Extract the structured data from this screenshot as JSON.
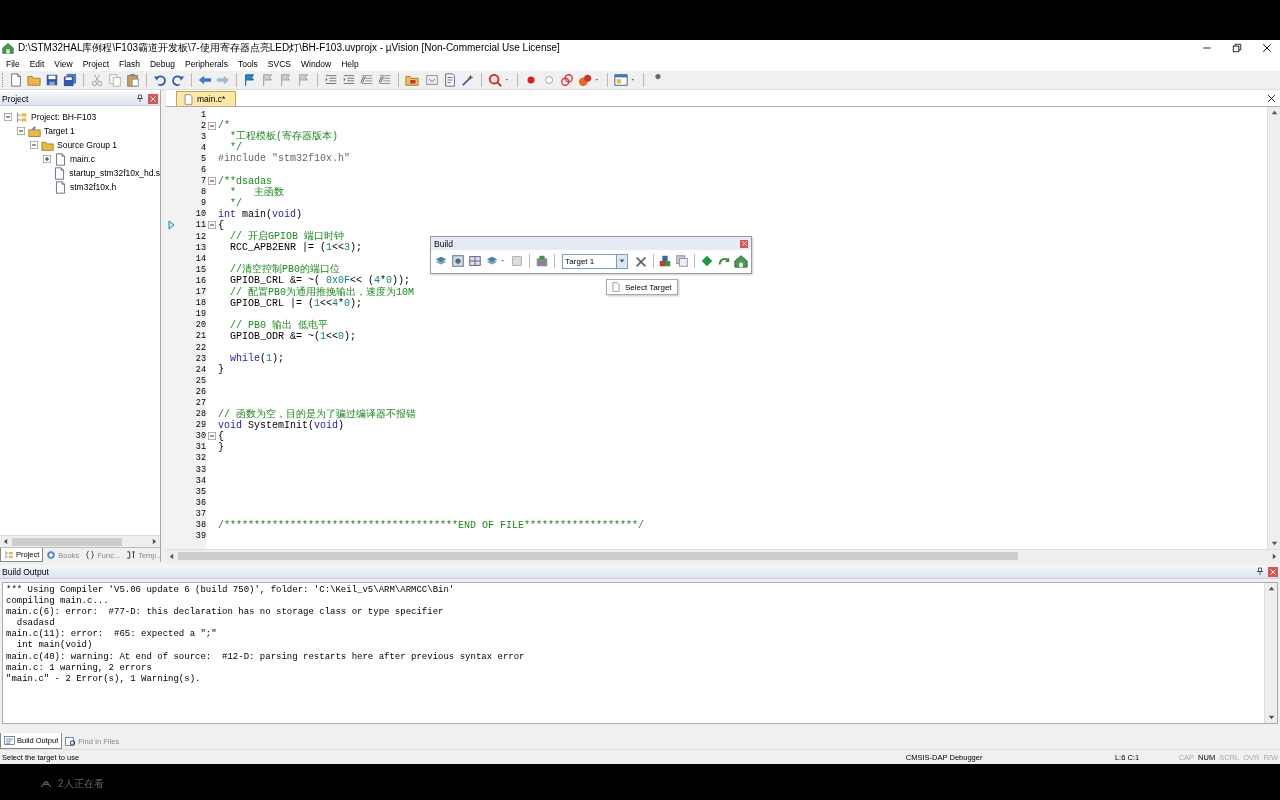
{
  "window": {
    "title": "D:\\STM32HAL库例程\\F103霸道开发板\\7-使用寄存器点亮LED灯\\BH-F103.uvprojx - µVision  [Non-Commercial Use License]"
  },
  "menu": [
    "File",
    "Edit",
    "View",
    "Project",
    "Flash",
    "Debug",
    "Peripherals",
    "Tools",
    "SVCS",
    "Window",
    "Help"
  ],
  "project_pane": {
    "title": "Project",
    "tree": [
      {
        "label": "Project: BH-F103",
        "kind": "project",
        "expanded": true,
        "children": [
          {
            "label": "Target 1",
            "kind": "target",
            "expanded": true,
            "children": [
              {
                "label": "Source Group 1",
                "kind": "group",
                "expanded": true,
                "children": [
                  {
                    "label": "main.c",
                    "kind": "file",
                    "expanded": false
                  },
                  {
                    "label": "startup_stm32f10x_hd.s",
                    "kind": "file"
                  },
                  {
                    "label": "stm32f10x.h",
                    "kind": "file"
                  }
                ]
              }
            ]
          }
        ]
      }
    ],
    "tabs": [
      {
        "label": "Project",
        "selected": true
      },
      {
        "label": "Books",
        "selected": false
      },
      {
        "label": "Func...",
        "selected": false
      },
      {
        "label": "Temp...",
        "selected": false
      }
    ]
  },
  "editor": {
    "tabs": [
      {
        "label": "main.c*",
        "selected": true
      }
    ],
    "lines": [
      {
        "number": "1",
        "fold": false,
        "current": false
      },
      {
        "number": "2",
        "fold": true,
        "current": false,
        "tokens": [
          {
            "kind": "comment",
            "text": "/*"
          }
        ]
      },
      {
        "number": "3",
        "fold": false,
        "current": false,
        "tokens": [
          {
            "kind": "comment",
            "text": "  *工程模板(寄存器版本)"
          }
        ]
      },
      {
        "number": "4",
        "fold": false,
        "current": false,
        "tokens": [
          {
            "kind": "comment",
            "text": "  */"
          }
        ]
      },
      {
        "number": "5",
        "fold": false,
        "current": false,
        "tokens": [
          {
            "kind": "preprocessor",
            "text": "#include \"stm32f10x.h\""
          }
        ]
      },
      {
        "number": "6",
        "fold": false,
        "current": false
      },
      {
        "number": "7",
        "fold": true,
        "current": false,
        "tokens": [
          {
            "kind": "comment",
            "text": "/**dsadas"
          }
        ]
      },
      {
        "number": "8",
        "fold": false,
        "current": false,
        "tokens": [
          {
            "kind": "comment",
            "text": "  *   主函数"
          }
        ]
      },
      {
        "number": "9",
        "fold": false,
        "current": false,
        "tokens": [
          {
            "kind": "comment",
            "text": "  */"
          }
        ]
      },
      {
        "number": "10",
        "fold": false,
        "current": false,
        "tokens": [
          {
            "kind": "keyword",
            "text": "int"
          },
          {
            "kind": "plain",
            "text": " main("
          },
          {
            "kind": "keyword",
            "text": "void"
          },
          {
            "kind": "plain",
            "text": ")"
          }
        ]
      },
      {
        "number": "11",
        "fold": true,
        "current": true,
        "tokens": [
          {
            "kind": "plain",
            "text": "{"
          }
        ]
      },
      {
        "number": "12",
        "fold": false,
        "current": false,
        "tokens": [
          {
            "kind": "comment",
            "text": "  // 开启GPIOB 端口时钟"
          }
        ]
      },
      {
        "number": "13",
        "fold": false,
        "current": false,
        "tokens": [
          {
            "kind": "plain",
            "text": "  RCC_APB2ENR |= ("
          },
          {
            "kind": "number",
            "text": "1"
          },
          {
            "kind": "plain",
            "text": "<<"
          },
          {
            "kind": "number",
            "text": "3"
          },
          {
            "kind": "plain",
            "text": ");"
          }
        ]
      },
      {
        "number": "14",
        "fold": false,
        "current": false
      },
      {
        "number": "15",
        "fold": false,
        "current": false,
        "tokens": [
          {
            "kind": "comment",
            "text": "  //清空控制PB0的端口位"
          }
        ]
      },
      {
        "number": "16",
        "fold": false,
        "current": false,
        "tokens": [
          {
            "kind": "plain",
            "text": "  GPIOB_CRL &= ~( "
          },
          {
            "kind": "number",
            "text": "0x0F"
          },
          {
            "kind": "plain",
            "text": "<< ("
          },
          {
            "kind": "number",
            "text": "4"
          },
          {
            "kind": "plain",
            "text": "*"
          },
          {
            "kind": "number",
            "text": "0"
          },
          {
            "kind": "plain",
            "text": "));"
          }
        ]
      },
      {
        "number": "17",
        "fold": false,
        "current": false,
        "tokens": [
          {
            "kind": "comment",
            "text": "  // 配置PB0为通用推挽输出，速度为10M"
          }
        ]
      },
      {
        "number": "18",
        "fold": false,
        "current": false,
        "tokens": [
          {
            "kind": "plain",
            "text": "  GPIOB_CRL |= ("
          },
          {
            "kind": "number",
            "text": "1"
          },
          {
            "kind": "plain",
            "text": "<<"
          },
          {
            "kind": "number",
            "text": "4"
          },
          {
            "kind": "plain",
            "text": "*"
          },
          {
            "kind": "number",
            "text": "0"
          },
          {
            "kind": "plain",
            "text": ");"
          }
        ]
      },
      {
        "number": "19",
        "fold": false,
        "current": false
      },
      {
        "number": "20",
        "fold": false,
        "current": false,
        "tokens": [
          {
            "kind": "comment",
            "text": "  // PB0 输出 低电平"
          }
        ]
      },
      {
        "number": "21",
        "fold": false,
        "current": false,
        "tokens": [
          {
            "kind": "plain",
            "text": "  GPIOB_ODR &= ~("
          },
          {
            "kind": "number",
            "text": "1"
          },
          {
            "kind": "plain",
            "text": "<<"
          },
          {
            "kind": "number",
            "text": "0"
          },
          {
            "kind": "plain",
            "text": ");"
          }
        ]
      },
      {
        "number": "22",
        "fold": false,
        "current": false
      },
      {
        "number": "23",
        "fold": false,
        "current": false,
        "tokens": [
          {
            "kind": "keyword",
            "text": "  while"
          },
          {
            "kind": "plain",
            "text": "("
          },
          {
            "kind": "number",
            "text": "1"
          },
          {
            "kind": "plain",
            "text": ");"
          }
        ]
      },
      {
        "number": "24",
        "fold": false,
        "current": false,
        "tokens": [
          {
            "kind": "plain",
            "text": "}"
          }
        ]
      },
      {
        "number": "25",
        "fold": false,
        "current": false
      },
      {
        "number": "26",
        "fold": false,
        "current": false
      },
      {
        "number": "27",
        "fold": false,
        "current": false
      },
      {
        "number": "28",
        "fold": false,
        "current": false,
        "tokens": [
          {
            "kind": "comment",
            "text": "// 函数为空，目的是为了骗过编译器不报错"
          }
        ]
      },
      {
        "number": "29",
        "fold": false,
        "current": false,
        "tokens": [
          {
            "kind": "keyword",
            "text": "void"
          },
          {
            "kind": "plain",
            "text": " SystemInit("
          },
          {
            "kind": "keyword",
            "text": "void"
          },
          {
            "kind": "plain",
            "text": ")"
          }
        ]
      },
      {
        "number": "30",
        "fold": true,
        "current": false,
        "tokens": [
          {
            "kind": "plain",
            "text": "{"
          }
        ]
      },
      {
        "number": "31",
        "fold": false,
        "current": false,
        "tokens": [
          {
            "kind": "plain",
            "text": "}"
          }
        ]
      },
      {
        "number": "32",
        "fold": false,
        "current": false
      },
      {
        "number": "33",
        "fold": false,
        "current": false
      },
      {
        "number": "34",
        "fold": false,
        "current": false
      },
      {
        "number": "35",
        "fold": false,
        "current": false
      },
      {
        "number": "36",
        "fold": false,
        "current": false
      },
      {
        "number": "37",
        "fold": false,
        "current": false
      },
      {
        "number": "38",
        "fold": false,
        "current": false,
        "tokens": [
          {
            "kind": "comment",
            "text": "/***************************************END OF FILE*******************/"
          }
        ]
      },
      {
        "number": "39",
        "fold": false,
        "current": false
      }
    ]
  },
  "build_toolbar": {
    "title": "Build",
    "target": "Target 1",
    "tooltip": "Select Target"
  },
  "build_output": {
    "title": "Build Output",
    "lines": [
      "*** Using Compiler 'V5.06 update 6 (build 750)', folder: 'C:\\Keil_v5\\ARM\\ARMCC\\Bin'",
      "compiling main.c...",
      "main.c(6): error:  #77-D: this declaration has no storage class or type specifier",
      "  dsadasd",
      "main.c(11): error:  #65: expected a \";\"",
      "  int main(void)",
      "main.c(40): warning: At end of source:  #12-D: parsing restarts here after previous syntax error",
      "main.c: 1 warning, 2 errors",
      "\"main.c\" - 2 Error(s), 1 Warning(s)."
    ],
    "tabs": [
      {
        "label": "Build Output",
        "selected": true
      },
      {
        "label": "Find In Files",
        "selected": false
      }
    ]
  },
  "status_bar": {
    "message": "Select the target to use",
    "debugger": "CMSIS-DAP Debugger",
    "position": "L:6 C:1",
    "indicators": [
      {
        "label": "CAP",
        "on": false
      },
      {
        "label": "NUM",
        "on": true
      },
      {
        "label": "SCRL",
        "on": false
      },
      {
        "label": "OVR",
        "on": false
      },
      {
        "label": "R/W",
        "on": false
      }
    ]
  },
  "viewers": {
    "text": "2人正在看"
  }
}
